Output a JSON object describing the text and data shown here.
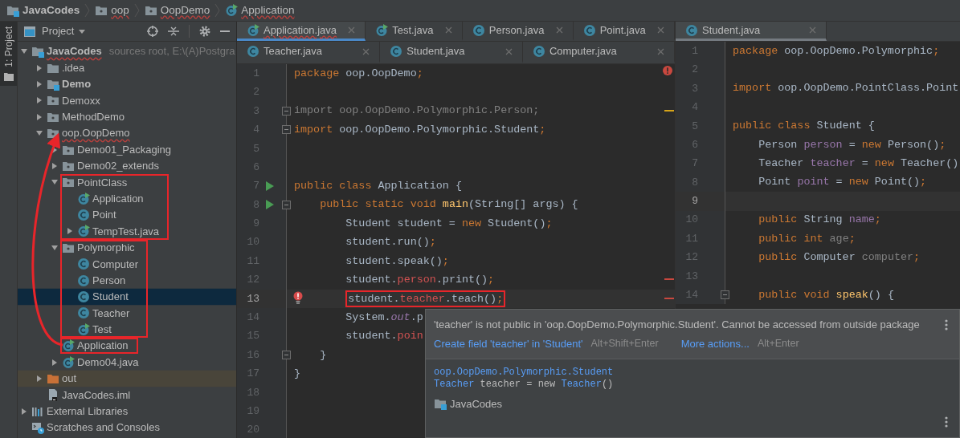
{
  "breadcrumb": [
    {
      "label": "JavaCodes",
      "kind": "module",
      "error": false
    },
    {
      "label": "oop",
      "kind": "package",
      "error": true
    },
    {
      "label": "OopDemo",
      "kind": "package",
      "error": true
    },
    {
      "label": "Application",
      "kind": "runclass",
      "error": true
    }
  ],
  "tool_strip": {
    "label": "1: Project",
    "selected": true
  },
  "project_panel": {
    "title": "Project",
    "tree": [
      {
        "label": "JavaCodes",
        "kind": "module",
        "note": "sources root,  E:\\(A)Postgra",
        "expanded": true,
        "selected": false,
        "error": true,
        "children": [
          {
            "label": ".idea",
            "kind": "folder",
            "expanded": false,
            "selected": false,
            "error": false
          },
          {
            "label": "Demo",
            "kind": "module",
            "expanded": false,
            "selected": false,
            "error": false
          },
          {
            "label": "Demoxx",
            "kind": "package",
            "expanded": false,
            "selected": false,
            "error": false
          },
          {
            "label": "MethodDemo",
            "kind": "package",
            "expanded": false,
            "selected": false,
            "error": false
          },
          {
            "label": "oop.OopDemo",
            "kind": "package",
            "expanded": true,
            "selected": false,
            "error": true,
            "children": [
              {
                "label": "Demo01_Packaging",
                "kind": "package",
                "expanded": false,
                "selected": false,
                "error": false
              },
              {
                "label": "Demo02_extends",
                "kind": "package",
                "expanded": false,
                "selected": false,
                "error": false
              },
              {
                "label": "PointClass",
                "kind": "package",
                "expanded": true,
                "selected": false,
                "error": false,
                "framed": true,
                "children": [
                  {
                    "label": "Application",
                    "kind": "runclass",
                    "selected": false,
                    "error": false
                  },
                  {
                    "label": "Point",
                    "kind": "class",
                    "selected": false,
                    "error": false
                  },
                  {
                    "label": "TempTest.java",
                    "kind": "runclass",
                    "expanded": false,
                    "selected": false,
                    "error": false
                  }
                ]
              },
              {
                "label": "Polymorphic",
                "kind": "package",
                "expanded": true,
                "selected": false,
                "error": false,
                "framed": true,
                "children": [
                  {
                    "label": "Computer",
                    "kind": "class",
                    "selected": false,
                    "error": false
                  },
                  {
                    "label": "Person",
                    "kind": "class",
                    "selected": false,
                    "error": false
                  },
                  {
                    "label": "Student",
                    "kind": "class",
                    "selected": true,
                    "error": false
                  },
                  {
                    "label": "Teacher",
                    "kind": "class",
                    "selected": false,
                    "error": false
                  },
                  {
                    "label": "Test",
                    "kind": "runclass",
                    "selected": false,
                    "error": false
                  }
                ]
              },
              {
                "label": "Application",
                "kind": "runclass",
                "selected": false,
                "error": false,
                "framed": true
              },
              {
                "label": "Demo04.java",
                "kind": "runclass",
                "expanded": false,
                "selected": false,
                "error": false
              }
            ]
          },
          {
            "label": "out",
            "kind": "excluded",
            "expanded": false,
            "selected": false,
            "error": false
          },
          {
            "label": "JavaCodes.iml",
            "kind": "file",
            "selected": false,
            "error": false
          }
        ]
      },
      {
        "label": "External Libraries",
        "kind": "libs",
        "expanded": false,
        "selected": false,
        "error": false
      },
      {
        "label": "Scratches and Consoles",
        "kind": "scratches",
        "selected": false,
        "error": false
      }
    ]
  },
  "editors": [
    {
      "focused": true,
      "has_errors": true,
      "tab_rows": [
        [
          {
            "label": "Application.java",
            "kind": "runclass",
            "selected": true,
            "error": true
          },
          {
            "label": "Test.java",
            "kind": "runclass",
            "selected": false,
            "error": false
          },
          {
            "label": "Person.java",
            "kind": "class",
            "selected": false,
            "error": false
          },
          {
            "label": "Point.java",
            "kind": "class",
            "selected": false,
            "error": false
          }
        ],
        [
          {
            "label": "Teacher.java",
            "kind": "class",
            "selected": false,
            "error": false
          },
          {
            "label": "Student.java",
            "kind": "class",
            "selected": false,
            "error": false
          },
          {
            "label": "Computer.java",
            "kind": "class",
            "selected": false,
            "error": false
          }
        ]
      ],
      "lines": [
        {
          "number": "1",
          "current": false,
          "tokens": [
            {
              "text": "package ",
              "kind": "kw"
            },
            {
              "text": "oop.OopDemo",
              "kind": "id"
            },
            {
              "text": ";",
              "kind": "kw"
            }
          ]
        },
        {
          "number": "2",
          "current": false
        },
        {
          "number": "3",
          "current": false,
          "fold": true,
          "warning_mark": true,
          "tokens": [
            {
              "text": "import oop.OopDemo.Polymorphic.Person;",
              "kind": "dim"
            }
          ]
        },
        {
          "number": "4",
          "current": false,
          "fold": true,
          "tokens": [
            {
              "text": "import ",
              "kind": "kw"
            },
            {
              "text": "oop.OopDemo.Polymorphic.Student",
              "kind": "id"
            },
            {
              "text": ";",
              "kind": "kw"
            }
          ]
        },
        {
          "number": "5",
          "current": false
        },
        {
          "number": "6",
          "current": false
        },
        {
          "number": "7",
          "current": false,
          "runnable": true,
          "tokens": [
            {
              "text": "public class ",
              "kind": "kw"
            },
            {
              "text": "Application {",
              "kind": "id"
            }
          ]
        },
        {
          "number": "8",
          "current": false,
          "fold": true,
          "runnable": true,
          "tokens": [
            {
              "text": "    public static void ",
              "kind": "kw"
            },
            {
              "text": "main",
              "kind": "fn"
            },
            {
              "text": "(String[] args) {",
              "kind": "id"
            }
          ]
        },
        {
          "number": "9",
          "current": false,
          "tokens": [
            {
              "text": "        Student student = ",
              "kind": "id"
            },
            {
              "text": "new ",
              "kind": "kw"
            },
            {
              "text": "Student()",
              "kind": "id"
            },
            {
              "text": ";",
              "kind": "kw"
            }
          ]
        },
        {
          "number": "10",
          "current": false,
          "tokens": [
            {
              "text": "        student.run()",
              "kind": "id"
            },
            {
              "text": ";",
              "kind": "kw"
            }
          ]
        },
        {
          "number": "11",
          "current": false,
          "tokens": [
            {
              "text": "        student.speak()",
              "kind": "id"
            },
            {
              "text": ";",
              "kind": "kw"
            }
          ]
        },
        {
          "number": "12",
          "current": false,
          "error_mark": true,
          "tokens": [
            {
              "text": "        student.",
              "kind": "id"
            },
            {
              "text": "person",
              "kind": "err"
            },
            {
              "text": ".print()",
              "kind": "id"
            },
            {
              "text": ";",
              "kind": "kw"
            }
          ]
        },
        {
          "number": "13",
          "current": true,
          "framed": true,
          "error_bulb": true,
          "error_mark": true,
          "tokens": [
            {
              "text": "        student.",
              "kind": "id"
            },
            {
              "text": "teacher",
              "kind": "err"
            },
            {
              "text": ".teach()",
              "kind": "id"
            },
            {
              "text": ";",
              "kind": "kw"
            }
          ]
        },
        {
          "number": "14",
          "current": false,
          "tokens": [
            {
              "text": "        System.",
              "kind": "id"
            },
            {
              "text": "out",
              "kind": "stat"
            },
            {
              "text": ".p",
              "kind": "id"
            }
          ]
        },
        {
          "number": "15",
          "current": false,
          "tokens": [
            {
              "text": "        student.",
              "kind": "id"
            },
            {
              "text": "poin",
              "kind": "err"
            }
          ]
        },
        {
          "number": "16",
          "current": false,
          "fold": true,
          "tokens": [
            {
              "text": "    }",
              "kind": "id"
            }
          ]
        },
        {
          "number": "17",
          "current": false,
          "tokens": [
            {
              "text": "}",
              "kind": "id"
            }
          ]
        },
        {
          "number": "18",
          "current": false
        },
        {
          "number": "19",
          "current": false
        },
        {
          "number": "20",
          "current": false
        }
      ]
    },
    {
      "focused": false,
      "has_errors": false,
      "tab_rows": [
        [
          {
            "label": "Student.java",
            "kind": "class",
            "selected": true,
            "error": false
          }
        ]
      ],
      "lines": [
        {
          "number": "1",
          "current": false,
          "tokens": [
            {
              "text": "package ",
              "kind": "kw"
            },
            {
              "text": "oop.OopDemo.Polymorphic",
              "kind": "id"
            },
            {
              "text": ";",
              "kind": "kw"
            }
          ]
        },
        {
          "number": "2",
          "current": false
        },
        {
          "number": "3",
          "current": false,
          "tokens": [
            {
              "text": "import ",
              "kind": "kw"
            },
            {
              "text": "oop.OopDemo.PointClass.Point",
              "kind": "id"
            }
          ]
        },
        {
          "number": "4",
          "current": false
        },
        {
          "number": "5",
          "current": false,
          "tokens": [
            {
              "text": "public class ",
              "kind": "kw"
            },
            {
              "text": "Student {",
              "kind": "id"
            }
          ]
        },
        {
          "number": "6",
          "current": false,
          "tokens": [
            {
              "text": "    Person ",
              "kind": "id"
            },
            {
              "text": "person",
              "kind": "fld"
            },
            {
              "text": " = ",
              "kind": "id"
            },
            {
              "text": "new ",
              "kind": "kw"
            },
            {
              "text": "Person()",
              "kind": "id"
            },
            {
              "text": ";",
              "kind": "kw"
            }
          ]
        },
        {
          "number": "7",
          "current": false,
          "tokens": [
            {
              "text": "    Teacher ",
              "kind": "id"
            },
            {
              "text": "teacher",
              "kind": "fld"
            },
            {
              "text": " = ",
              "kind": "id"
            },
            {
              "text": "new ",
              "kind": "kw"
            },
            {
              "text": "Teacher()",
              "kind": "id"
            }
          ]
        },
        {
          "number": "8",
          "current": false,
          "tokens": [
            {
              "text": "    Point ",
              "kind": "id"
            },
            {
              "text": "point",
              "kind": "fld"
            },
            {
              "text": " = ",
              "kind": "id"
            },
            {
              "text": "new ",
              "kind": "kw"
            },
            {
              "text": "Point()",
              "kind": "id"
            },
            {
              "text": ";",
              "kind": "kw"
            }
          ]
        },
        {
          "number": "9",
          "current": true
        },
        {
          "number": "10",
          "current": false,
          "tokens": [
            {
              "text": "    public ",
              "kind": "kw"
            },
            {
              "text": "String ",
              "kind": "id"
            },
            {
              "text": "name",
              "kind": "fld"
            },
            {
              "text": ";",
              "kind": "kw"
            }
          ]
        },
        {
          "number": "11",
          "current": false,
          "tokens": [
            {
              "text": "    public int ",
              "kind": "kw"
            },
            {
              "text": "age",
              "kind": "dim"
            },
            {
              "text": ";",
              "kind": "kw"
            }
          ]
        },
        {
          "number": "12",
          "current": false,
          "tokens": [
            {
              "text": "    public ",
              "kind": "kw"
            },
            {
              "text": "Computer ",
              "kind": "id"
            },
            {
              "text": "computer",
              "kind": "dim"
            },
            {
              "text": ";",
              "kind": "kw"
            }
          ]
        },
        {
          "number": "13",
          "current": false
        },
        {
          "number": "14",
          "current": false,
          "fold": true,
          "tokens": [
            {
              "text": "    public void ",
              "kind": "kw"
            },
            {
              "text": "speak",
              "kind": "fn"
            },
            {
              "text": "() {",
              "kind": "id"
            }
          ]
        }
      ]
    }
  ],
  "popup": {
    "message": "'teacher' is not public in 'oop.OopDemo.Polymorphic.Student'. Cannot be accessed from outside package",
    "actions": [
      {
        "label": "Create field 'teacher' in 'Student'",
        "shortcut": "Alt+Shift+Enter"
      },
      {
        "label": "More actions...",
        "shortcut": "Alt+Enter"
      }
    ],
    "declaration": [
      [
        {
          "text": "oop.OopDemo.Polymorphic.Student",
          "kind": "type"
        }
      ],
      [
        {
          "text": "Teacher",
          "kind": "type"
        },
        {
          "text": " teacher = new ",
          "kind": "plain"
        },
        {
          "text": "Teacher",
          "kind": "type"
        },
        {
          "text": "()",
          "kind": "plain"
        }
      ]
    ],
    "module": "JavaCodes"
  }
}
